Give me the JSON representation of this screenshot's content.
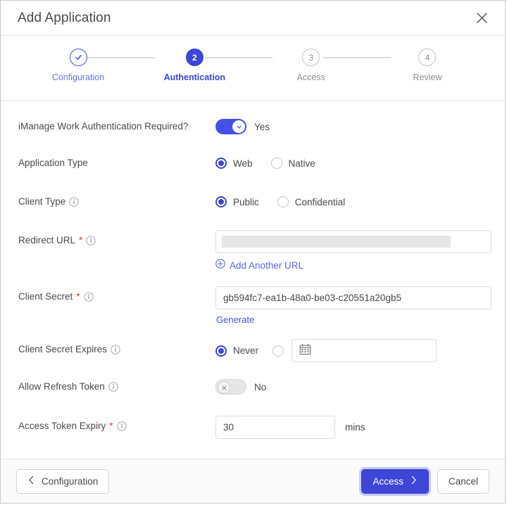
{
  "dialog": {
    "title": "Add Application",
    "close_icon": "close-icon"
  },
  "stepper": {
    "steps": [
      {
        "number": "✓",
        "label": "Configuration",
        "state": "done"
      },
      {
        "number": "2",
        "label": "Authentication",
        "state": "active"
      },
      {
        "number": "3",
        "label": "Access",
        "state": "upcoming"
      },
      {
        "number": "4",
        "label": "Review",
        "state": "upcoming"
      }
    ]
  },
  "form": {
    "imanage_auth": {
      "label": "iManage Work Authentication Required?",
      "toggle_state": "on",
      "toggle_text": "Yes",
      "knob_icon": "chevron-down-icon"
    },
    "application_type": {
      "label": "Application Type",
      "options": [
        "Web",
        "Native"
      ],
      "selected": "Web"
    },
    "client_type": {
      "label": "Client Type",
      "info_icon": "info-icon",
      "options": [
        "Public",
        "Confidential"
      ],
      "selected": "Public"
    },
    "redirect_url": {
      "label": "Redirect URL",
      "required_mark": "*",
      "info_icon": "info-icon",
      "value": "",
      "placeholder": "",
      "redacted": true,
      "add_another": "Add Another URL",
      "add_icon": "plus-circle-icon"
    },
    "client_secret": {
      "label": "Client Secret",
      "required_mark": "*",
      "info_icon": "info-icon",
      "value": "gb594fc7-ea1b-48a0-be03-c20551a20gb5",
      "generate_label": "Generate"
    },
    "client_secret_expires": {
      "label": "Client Secret Expires",
      "info_icon": "info-icon",
      "options": [
        "Never",
        ""
      ],
      "selected": "Never",
      "date_value": "",
      "calendar_icon": "calendar-icon"
    },
    "allow_refresh_token": {
      "label": "Allow Refresh Token",
      "info_icon": "info-icon",
      "toggle_state": "off",
      "toggle_text": "No",
      "knob_icon": "close-x-icon"
    },
    "access_token_expiry": {
      "label": "Access Token Expiry",
      "required_mark": "*",
      "info_icon": "info-icon",
      "value": "30",
      "suffix": "mins"
    }
  },
  "footer": {
    "back_label": "Configuration",
    "back_icon": "chevron-left-icon",
    "next_label": "Access",
    "next_icon": "chevron-right-icon",
    "cancel_label": "Cancel"
  },
  "colors": {
    "accent": "#3d46d6",
    "accent_light": "#5a63ea",
    "required": "#e03b3b",
    "border": "#dcdcdc",
    "muted_text": "#8d8d8d"
  }
}
